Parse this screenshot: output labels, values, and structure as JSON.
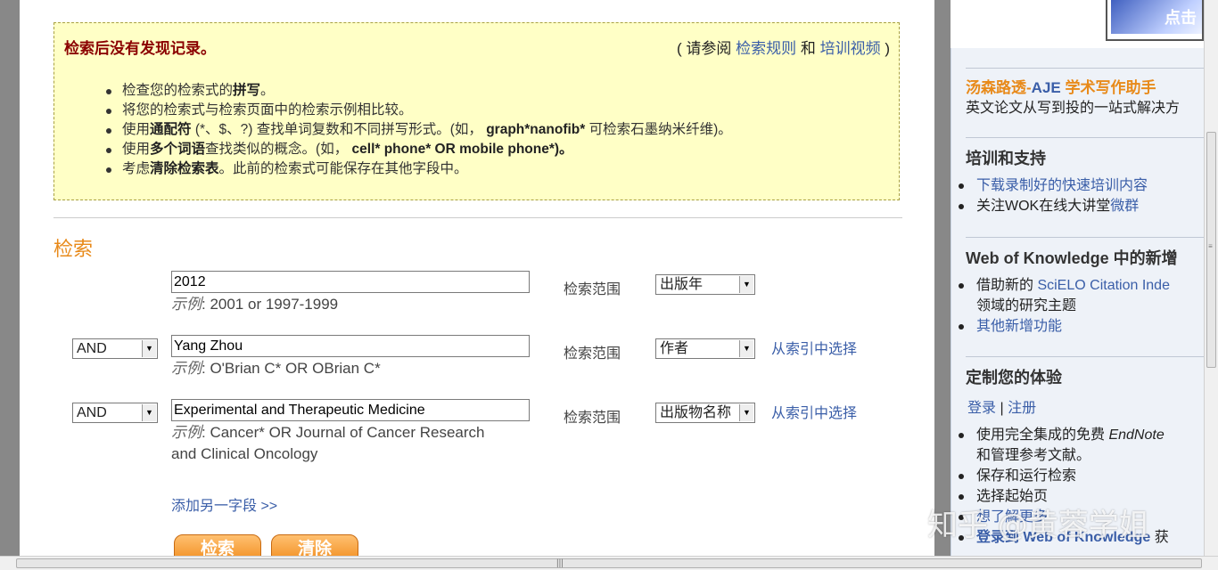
{
  "no_results": {
    "title": "检索后没有发现记录。",
    "ref_prefix": "( 请参阅",
    "ref_link1": "检索规则",
    "ref_and": "和",
    "ref_link2": "培训视频",
    "ref_suffix": ")",
    "tips": [
      {
        "pre": "检查您的检索式的",
        "bold": "拼写",
        "post": "。"
      },
      {
        "pre": "将您的检索式与检索页面中的检索示例相比较。",
        "bold": "",
        "post": ""
      },
      {
        "pre": "使用",
        "bold": "通配符",
        "post": " (*、$、?) 查找单词复数和不同拼写形式。(如， ",
        "bold2": "graph*nanofib*",
        "post2": " 可检索石墨纳米纤维)。"
      },
      {
        "pre": "使用",
        "bold": "多个词语",
        "post": "查找类似的概念。(如， ",
        "bold2": "cell* phone* OR mobile phone*)。",
        "post2": ""
      },
      {
        "pre": "考虑",
        "bold": "清除检索表",
        "post": "。此前的检索式可能保存在其他字段中。"
      }
    ]
  },
  "search": {
    "section_title": "检索",
    "rows": [
      {
        "operator": "",
        "value": "2012",
        "example_label": "示例",
        "example": ": 2001 or 1997-1999",
        "example2": "",
        "scope_label": "检索范围",
        "scope": "出版年",
        "index_link": ""
      },
      {
        "operator": "AND",
        "value": "Yang Zhou",
        "example_label": "示例",
        "example": ": O'Brian C* OR OBrian C*",
        "example2": "",
        "scope_label": "检索范围",
        "scope": "作者",
        "index_link": "从索引中选择"
      },
      {
        "operator": "AND",
        "value": "Experimental and Therapeutic Medicine",
        "example_label": "示例",
        "example": ": Cancer* OR Journal of Cancer Research",
        "example2": "and Clinical Oncology",
        "scope_label": "检索范围",
        "scope": "出版物名称",
        "index_link": "从索引中选择"
      }
    ],
    "add_field": "添加另一字段 >>",
    "search_button": "检索",
    "clear_button": "清除"
  },
  "sidebar": {
    "ad_text": "点击",
    "promo_title_a": "汤森路透-",
    "promo_title_b": "AJE",
    "promo_title_c": " 学术写作助手",
    "promo_sub": "英文论文从写到投的一站式解决方",
    "training_title": "培训和支持",
    "training_items": [
      {
        "pre": "",
        "link": "下载录制好的快速培训内容"
      },
      {
        "pre": "关注WOK在线大讲堂",
        "link": "微群"
      }
    ],
    "new_title": "Web of Knowledge 中的新增",
    "new_item1_pre": "借助新的 ",
    "new_item1_link": "SciELO Citation Inde",
    "new_item1_cont": "领域的研究主题",
    "new_item2_link": "其他新增功能",
    "custom_title": "定制您的体验",
    "login": "登录",
    "sep": "|",
    "register": "注册",
    "custom_item1_pre": "使用完全集成的免费 ",
    "custom_item1_em": "EndNote",
    "custom_item1_cont": "和管理参考文献。",
    "custom_item2": "保存和运行检索",
    "custom_item3": "选择起始页",
    "custom_item4": "想了解更多",
    "custom_item5_link": "登录到 Web of Knowledge",
    "custom_item5_post": " 获"
  },
  "watermark": "知乎 @黄蓉学姐",
  "colors": {
    "accent_orange": "#e88a1a",
    "link_blue": "#3a5ea8",
    "notice_bg": "#ffffc6",
    "notice_title": "#8b0000"
  }
}
